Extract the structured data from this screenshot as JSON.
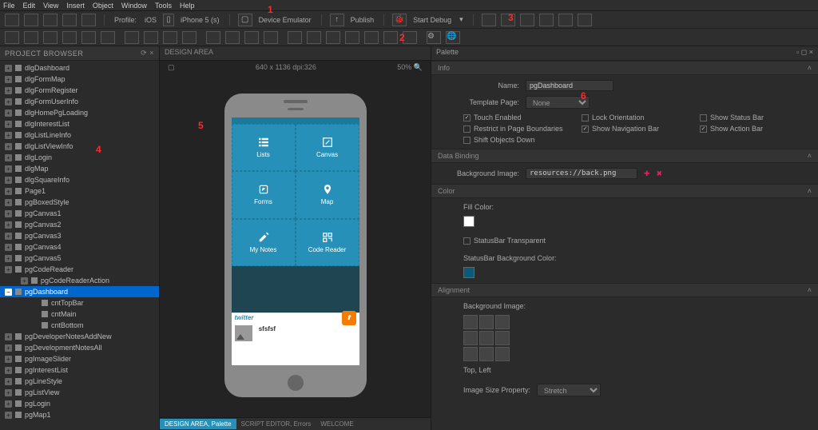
{
  "menubar": {
    "items": [
      "File",
      "Edit",
      "View",
      "Insert",
      "Object",
      "Window",
      "Tools",
      "Help"
    ]
  },
  "toolbar": {
    "profile_label": "Profile:",
    "profile_value": "iOS",
    "device_label": "iPhone 5 (s)",
    "device_emulator": "Device Emulator",
    "publish": "Publish",
    "start_debug": "Start Debug"
  },
  "project_browser": {
    "title": "PROJECT BROWSER",
    "items": [
      {
        "label": "dlgDashboard",
        "lvl": 0
      },
      {
        "label": "dlgFormMap",
        "lvl": 0
      },
      {
        "label": "dlgFormRegister",
        "lvl": 0
      },
      {
        "label": "dlgFormUserInfo",
        "lvl": 0
      },
      {
        "label": "dlgHomePgLoading",
        "lvl": 0
      },
      {
        "label": "dlgInterestList",
        "lvl": 0
      },
      {
        "label": "dlgListLineInfo",
        "lvl": 0
      },
      {
        "label": "dlgListViewInfo",
        "lvl": 0
      },
      {
        "label": "dlgLogin",
        "lvl": 0
      },
      {
        "label": "dlgMap",
        "lvl": 0
      },
      {
        "label": "dlgSquareInfo",
        "lvl": 0
      },
      {
        "label": "Page1",
        "lvl": 0
      },
      {
        "label": "pgBoxedStyle",
        "lvl": 0
      },
      {
        "label": "pgCanvas1",
        "lvl": 0
      },
      {
        "label": "pgCanvas2",
        "lvl": 0
      },
      {
        "label": "pgCanvas3",
        "lvl": 0
      },
      {
        "label": "pgCanvas4",
        "lvl": 0
      },
      {
        "label": "pgCanvas5",
        "lvl": 0
      },
      {
        "label": "pgCodeReader",
        "lvl": 0
      },
      {
        "label": "pgCodeReaderAction",
        "lvl": 1
      },
      {
        "label": "pgDashboard",
        "lvl": 0,
        "selected": true
      },
      {
        "label": "cntTopBar",
        "lvl": 2
      },
      {
        "label": "cntMain",
        "lvl": 2
      },
      {
        "label": "cntBottom",
        "lvl": 2
      },
      {
        "label": "pgDeveloperNotesAddNew",
        "lvl": 0
      },
      {
        "label": "pgDevelopmentNotesAll",
        "lvl": 0
      },
      {
        "label": "pgImageSlider",
        "lvl": 0
      },
      {
        "label": "pgInterestList",
        "lvl": 0
      },
      {
        "label": "pgLineStyle",
        "lvl": 0
      },
      {
        "label": "pgListView",
        "lvl": 0
      },
      {
        "label": "pgLogin",
        "lvl": 0
      },
      {
        "label": "pgMap1",
        "lvl": 0
      }
    ]
  },
  "design_area": {
    "title": "DESIGN AREA",
    "dimensions": "640 x 1136 dpi:326",
    "zoom": "50%",
    "tiles": [
      {
        "label": "Lists"
      },
      {
        "label": "Canvas"
      },
      {
        "label": "Forms"
      },
      {
        "label": "Map"
      },
      {
        "label": "My Notes"
      },
      {
        "label": "Code Reader"
      }
    ],
    "twitter_label": "twitter",
    "feed_text": "sfsfsf"
  },
  "bottom_tabs": {
    "items": [
      "DESIGN AREA, Palette",
      "SCRIPT EDITOR, Errors",
      "WELCOME"
    ],
    "active": 0
  },
  "palette": {
    "title": "Palette",
    "sections": {
      "info": {
        "title": "Info",
        "name_label": "Name:",
        "name_value": "pgDashboard",
        "template_label": "Template Page:",
        "template_value": "None",
        "checks": [
          {
            "label": "Touch Enabled",
            "checked": true
          },
          {
            "label": "Lock Orientation",
            "checked": false
          },
          {
            "label": "Show Status Bar",
            "checked": false
          },
          {
            "label": "Restrict in Page Boundaries",
            "checked": false
          },
          {
            "label": "Show Navigation Bar",
            "checked": true
          },
          {
            "label": "Show Action Bar",
            "checked": true
          },
          {
            "label": "Shift Objects Down",
            "checked": false
          }
        ]
      },
      "data_binding": {
        "title": "Data Binding",
        "bg_label": "Background Image:",
        "bg_value": "resources://back.png"
      },
      "color": {
        "title": "Color",
        "fill_label": "Fill Color:",
        "statusbar_transparent": "StatusBar Transparent",
        "statusbar_bg_label": "StatusBar Background Color:"
      },
      "alignment": {
        "title": "Alignment",
        "bg_image_label": "Background Image:",
        "pos_label": "Top, Left",
        "size_label": "Image Size Property:",
        "size_value": "Stretch"
      }
    }
  },
  "callouts": [
    "1",
    "2",
    "3",
    "4",
    "5",
    "6"
  ]
}
